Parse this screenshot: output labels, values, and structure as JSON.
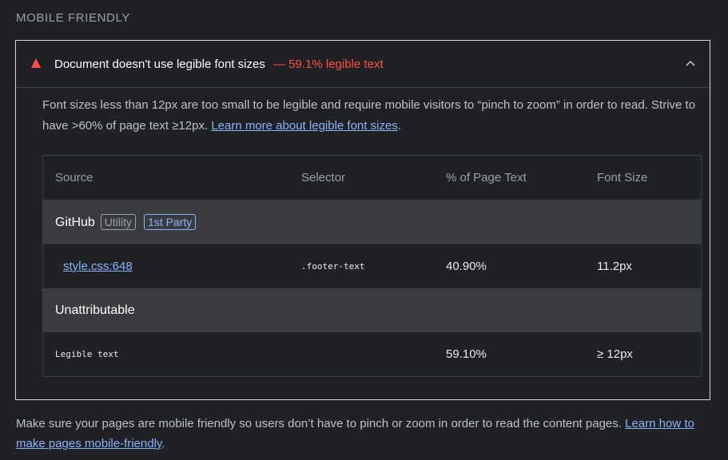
{
  "section": {
    "title": "MOBILE FRIENDLY"
  },
  "audit": {
    "status_icon": "fail-triangle-icon",
    "title": "Document doesn't use legible font sizes",
    "score_text": "— 59.1% legible text",
    "collapse_icon": "chevron-up-icon",
    "description": "Font sizes less than 12px are too small to be legible and require mobile visitors to “pinch to zoom” in order to read. Strive to have >60% of page text ≥12px.",
    "learn_more": "Learn more about legible font sizes",
    "desc_end": "."
  },
  "table": {
    "headers": [
      "Source",
      "Selector",
      "% of Page Text",
      "Font Size"
    ],
    "groups": [
      {
        "name": "GitHub",
        "badges": [
          "Utility",
          "1st Party"
        ],
        "rows": [
          {
            "source": "style.css:648",
            "selector": ".footer-text",
            "percent": "40.90%",
            "font_size": "11.2px"
          }
        ]
      },
      {
        "name": "Unattributable",
        "rows": [
          {
            "source": "Legible text",
            "selector": "",
            "percent": "59.10%",
            "font_size": "≥ 12px"
          }
        ]
      }
    ]
  },
  "footer": {
    "text": "Make sure your pages are mobile friendly so users don’t have to pinch or zoom in order to read the content pages.",
    "link": "Learn how to make pages mobile-friendly",
    "end": "."
  },
  "colors": {
    "fail": "#ff4e42",
    "link": "#8ab4f8",
    "background": "#202124"
  }
}
